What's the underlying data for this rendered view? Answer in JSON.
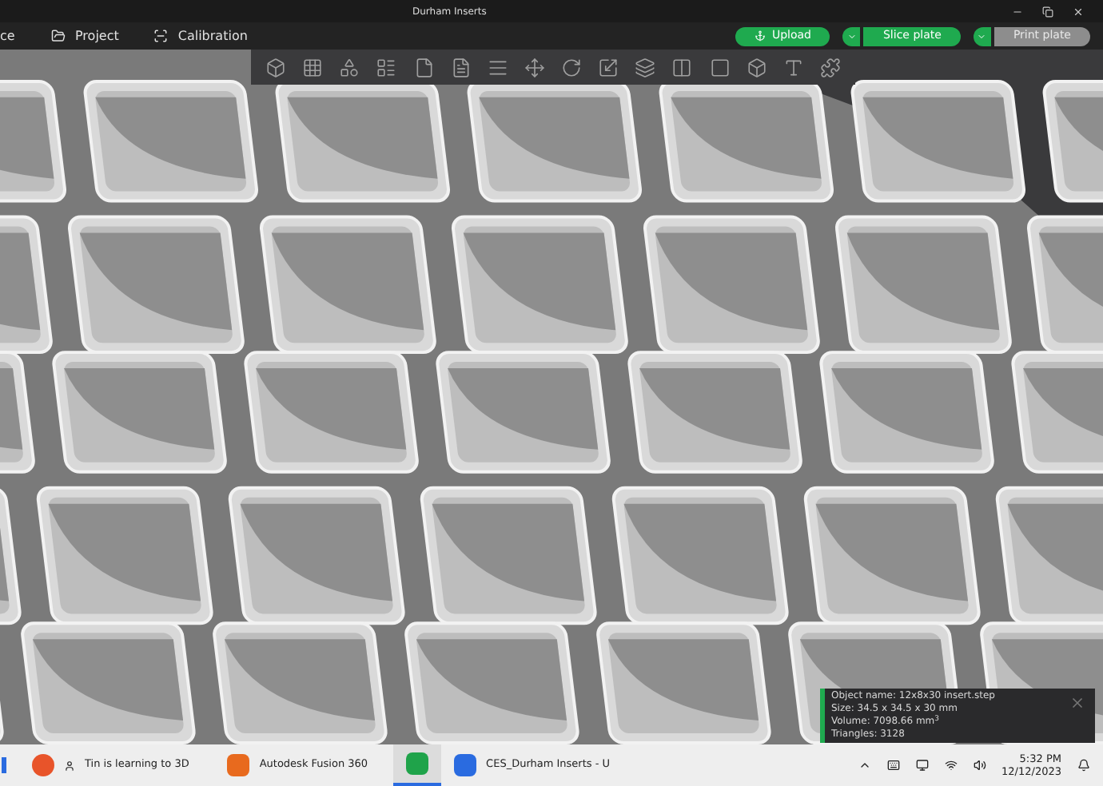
{
  "window": {
    "title": "Durham Inserts"
  },
  "menu": {
    "cut_item": "ce",
    "tabs": [
      {
        "label": "Project",
        "kind": "project"
      },
      {
        "label": "Calibration",
        "kind": "calibration"
      }
    ]
  },
  "actions": [
    {
      "label": "Upload",
      "kind": "upload",
      "disabled": false
    },
    {
      "label": "Slice plate",
      "kind": "split",
      "disabled": false
    },
    {
      "label": "Print plate",
      "kind": "split",
      "disabled": true
    }
  ],
  "info_panel": {
    "lines": [
      "Object name: 12x8x30 insert.step",
      "Size: 34.5 x 34.5 x 30 mm",
      "Volume: 7098.66 mm$^{3}$",
      "Triangles: 3128"
    ]
  },
  "taskbar": {
    "items": [
      {
        "label": "Tin is learning to 3D",
        "kind": "browser",
        "selected": false
      },
      {
        "label": "Autodesk Fusion 360",
        "kind": "fusion",
        "selected": false
      },
      {
        "kind": "app",
        "selected": true
      },
      {
        "label": "CES_Durham Inserts - U",
        "kind": "doc",
        "selected": false
      }
    ],
    "time": "5:32 PM",
    "date": "12/12/2023"
  }
}
